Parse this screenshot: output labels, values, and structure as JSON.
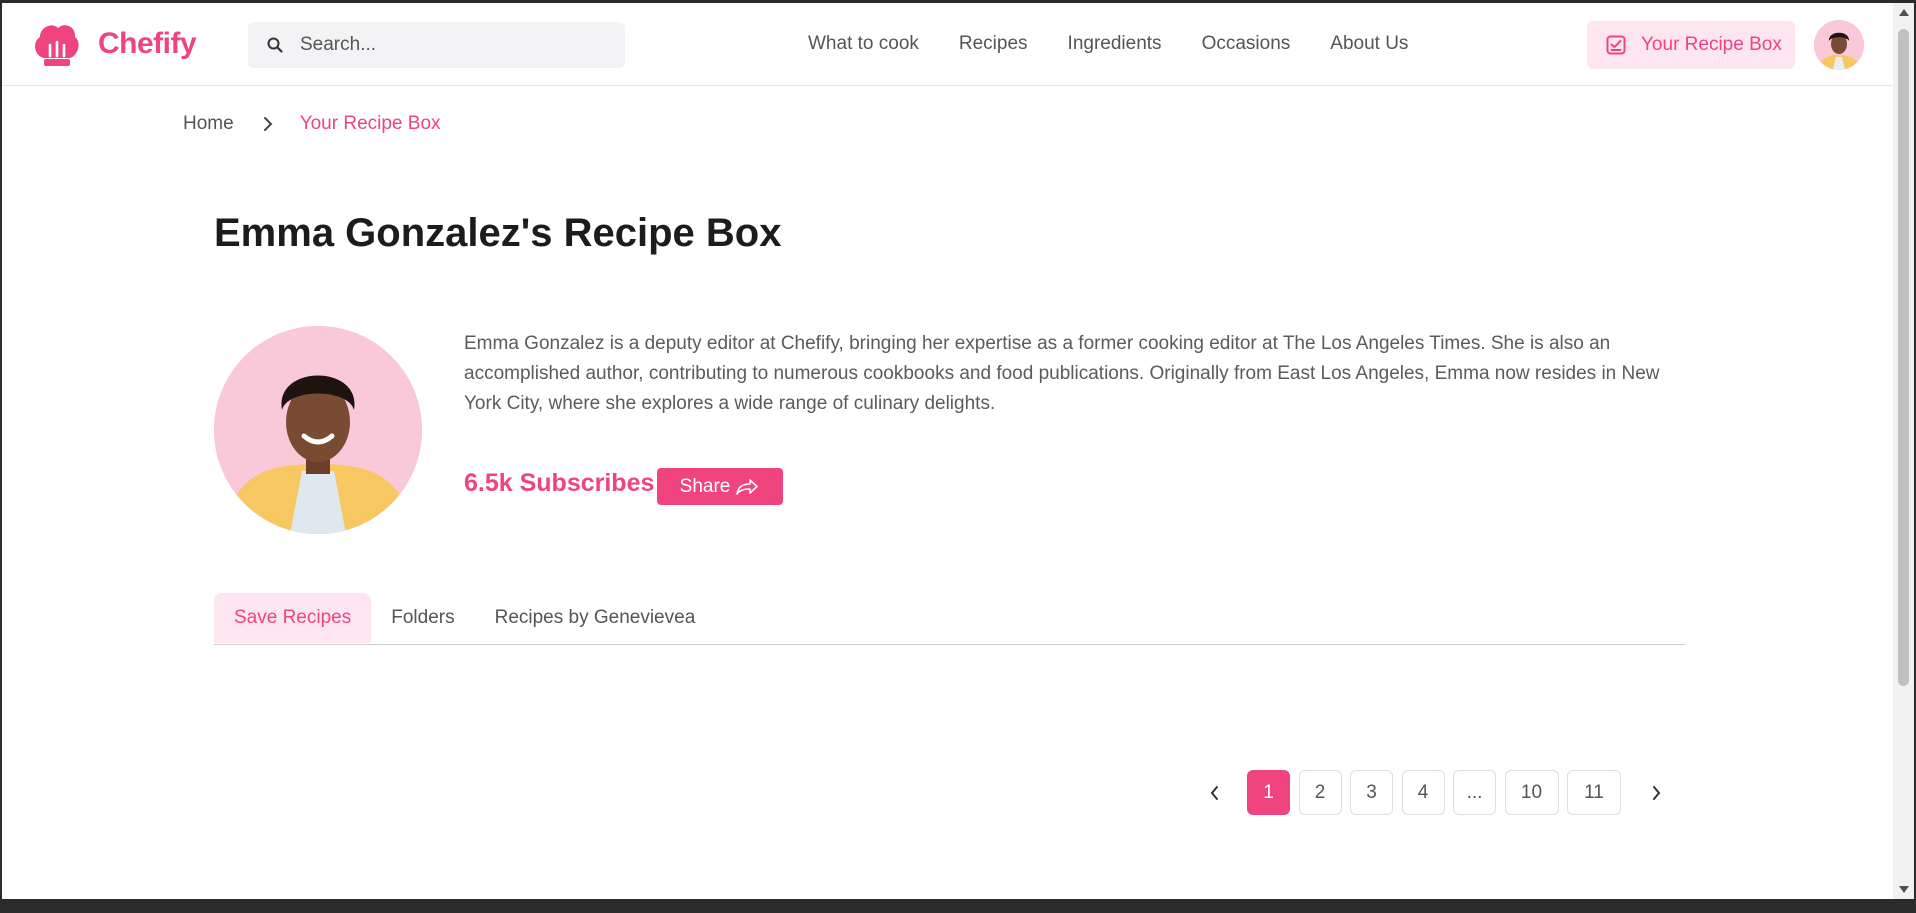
{
  "app": {
    "name": "Chefify"
  },
  "search": {
    "placeholder": "Search..."
  },
  "nav": {
    "items": [
      "What to cook",
      "Recipes",
      "Ingredients",
      "Occasions",
      "About Us"
    ]
  },
  "header": {
    "recipe_box_label": "Your Recipe Box"
  },
  "breadcrumb": {
    "home": "Home",
    "current": "Your Recipe Box"
  },
  "profile": {
    "title": "Emma Gonzalez's Recipe Box",
    "bio": "Emma Gonzalez is a deputy editor at Chefify, bringing her expertise as a former cooking editor at The Los Angeles Times. She is also an accomplished author, contributing to numerous cookbooks and food publications. Originally from East Los Angeles, Emma now resides in New York City, where she explores a wide range of culinary delights.",
    "subscribers": "6.5k Subscribes",
    "share_label": "Share"
  },
  "tabs": [
    "Save Recipes",
    "Folders",
    "Recipes by Genevievea"
  ],
  "active_tab": "Save Recipes",
  "pagination": {
    "pages": [
      "1",
      "2",
      "3",
      "4",
      "...",
      "10",
      "11"
    ],
    "current": "1"
  },
  "colors": {
    "brand": "#f0447f",
    "brand_light": "#fde6ef",
    "avatar_bg": "#f9c9da"
  }
}
